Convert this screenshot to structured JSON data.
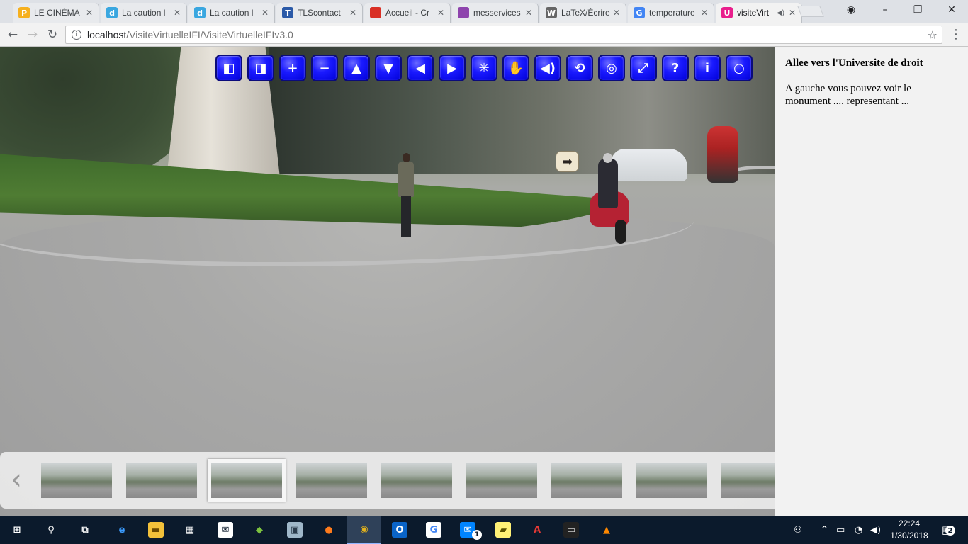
{
  "browser": {
    "tabs": [
      {
        "title": "LE CINÉMA",
        "favicon": "P",
        "color": "#f6b01e"
      },
      {
        "title": "La caution l",
        "favicon": "d",
        "color": "#3aa7e0"
      },
      {
        "title": "La caution l",
        "favicon": "d",
        "color": "#3aa7e0"
      },
      {
        "title": "TLScontact",
        "favicon": "T",
        "color": "#2b5aa8"
      },
      {
        "title": "Accueil - Cr",
        "favicon": "",
        "color": "#d93025"
      },
      {
        "title": "messervices",
        "favicon": "",
        "color": "#8e44ad"
      },
      {
        "title": "LaTeX/Écrire",
        "favicon": "W",
        "color": "#666666"
      },
      {
        "title": "temperature",
        "favicon": "G",
        "color": "#4285f4"
      },
      {
        "title": "visiteVirt",
        "favicon": "U",
        "color": "#e91e8c",
        "active": true,
        "audio": true
      }
    ],
    "url_host": "localhost",
    "url_path": "/VisiteVirtuelleIFI/VisiteVirtuelleIFIv3.0"
  },
  "viewer": {
    "controls": [
      {
        "name": "view-left-icon",
        "glyph": "◧"
      },
      {
        "name": "view-right-icon",
        "glyph": "◨"
      },
      {
        "name": "zoom-in-icon",
        "glyph": "+"
      },
      {
        "name": "zoom-out-icon",
        "glyph": "−"
      },
      {
        "name": "arrow-up-icon",
        "glyph": "▲"
      },
      {
        "name": "arrow-down-icon",
        "glyph": "▼"
      },
      {
        "name": "arrow-left-icon",
        "glyph": "◀"
      },
      {
        "name": "arrow-right-icon",
        "glyph": "▶"
      },
      {
        "name": "autorotate-icon",
        "glyph": "✳"
      },
      {
        "name": "hand-icon",
        "glyph": "✋"
      },
      {
        "name": "sound-icon",
        "glyph": "◀)"
      },
      {
        "name": "rotate-icon",
        "glyph": "⟲"
      },
      {
        "name": "vr-icon",
        "glyph": "◎"
      },
      {
        "name": "fullscreen-icon",
        "glyph": "⤢"
      },
      {
        "name": "help-icon",
        "glyph": "?"
      },
      {
        "name": "info-icon",
        "glyph": "i"
      },
      {
        "name": "close-icon",
        "glyph": "○"
      }
    ],
    "hotspot_glyph": "➡",
    "thumbnails_count": 9,
    "selected_thumbnail": 3
  },
  "panel": {
    "title": "Allee vers l'Universite de droit",
    "text": "A gauche vous pouvez voir le monument .... representant ..."
  },
  "taskbar": {
    "apps": [
      "start-icon",
      "search-icon",
      "task-view-icon",
      "edge-icon",
      "file-explorer-icon",
      "store-icon",
      "mail-icon",
      "bluestacks-icon",
      "photos-icon",
      "firefox-icon",
      "chrome-icon",
      "outlook-icon",
      "google-icon",
      "messenger-icon",
      "sticky-notes-icon",
      "acrobat-icon",
      "terminal-icon",
      "vlc-icon"
    ],
    "messenger_badge": "1",
    "time": "22:24",
    "date": "1/30/2018",
    "notifications": "2"
  }
}
